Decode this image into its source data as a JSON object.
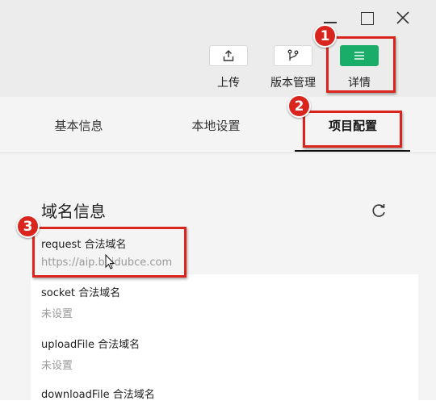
{
  "toolbar": {
    "upload_label": "上传",
    "version_label": "版本管理",
    "detail_label": "详情"
  },
  "tabs": {
    "basic": "基本信息",
    "local": "本地设置",
    "project": "项目配置"
  },
  "section": {
    "title": "域名信息"
  },
  "domains": [
    {
      "label": "request 合法域名",
      "value": "https://aip.baidubce.com"
    },
    {
      "label": "socket 合法域名",
      "value": "未设置"
    },
    {
      "label": "uploadFile 合法域名",
      "value": "未设置"
    },
    {
      "label": "downloadFile 合法域名",
      "value": ""
    }
  ],
  "annotations": [
    "1",
    "2",
    "3"
  ],
  "colors": {
    "accent_green": "#1aad6a",
    "annotation_red": "#d9251d"
  },
  "icons": {
    "upload": "upload-icon",
    "version": "branch-icon",
    "detail": "menu-icon",
    "refresh": "refresh-icon"
  }
}
